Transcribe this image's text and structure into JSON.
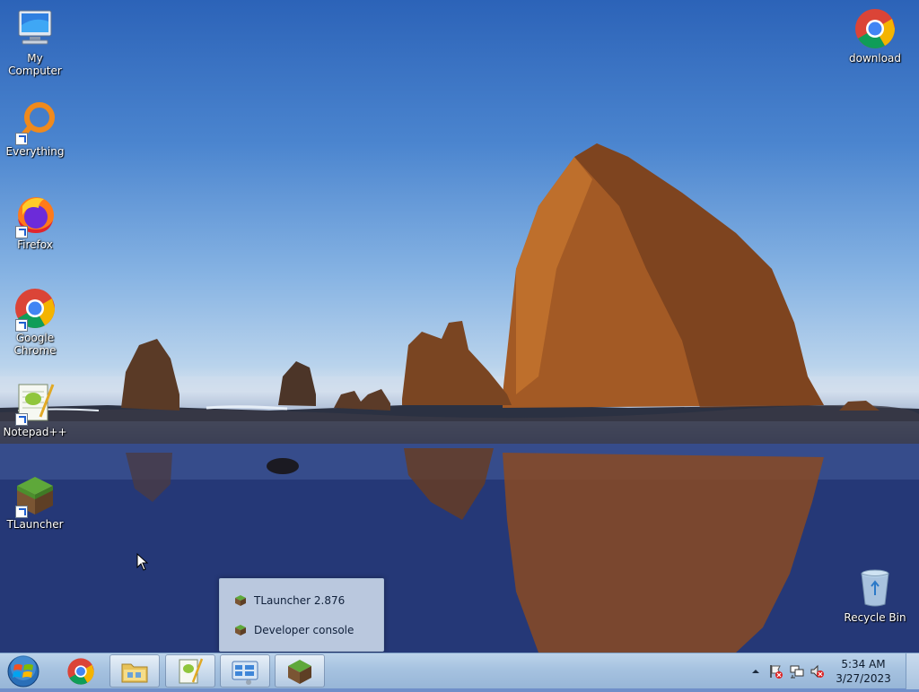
{
  "desktop": {
    "icons": [
      {
        "label": "My Computer",
        "icon": "computer-icon"
      },
      {
        "label": "Everything",
        "icon": "everything-search-icon"
      },
      {
        "label": "Firefox",
        "icon": "firefox-icon"
      },
      {
        "label": "Google Chrome",
        "icon": "chrome-icon"
      },
      {
        "label": "Notepad++",
        "icon": "notepadpp-icon"
      },
      {
        "label": "TLauncher",
        "icon": "tlauncher-grass-block-icon"
      },
      {
        "label": "download",
        "icon": "chrome-icon"
      },
      {
        "label": "Recycle Bin",
        "icon": "recycle-bin-icon"
      }
    ]
  },
  "popup": {
    "items": [
      {
        "label": "TLauncher 2.876",
        "icon": "tlauncher-grass-block-icon"
      },
      {
        "label": "Developer console",
        "icon": "tlauncher-grass-block-icon"
      }
    ]
  },
  "taskbar": {
    "buttons": [
      {
        "name": "start",
        "icon": "windows-orb-icon"
      },
      {
        "name": "chrome",
        "icon": "chrome-icon"
      },
      {
        "name": "file-explorer",
        "icon": "folder-icon"
      },
      {
        "name": "notepadpp",
        "icon": "notepadpp-icon"
      },
      {
        "name": "control-panel",
        "icon": "control-panel-icon"
      },
      {
        "name": "tlauncher",
        "icon": "tlauncher-grass-block-icon"
      }
    ],
    "tray": {
      "icons": [
        "show-hidden-icons-arrow",
        "action-center-flag-icon",
        "network-icon",
        "volume-muted-icon"
      ],
      "time": "5:34 AM",
      "date": "3/27/2023"
    }
  },
  "colors": {
    "taskbar": "#a6c2e0",
    "chrome_red": "#db4437",
    "chrome_green": "#0f9d58",
    "chrome_yellow": "#f4b400",
    "chrome_blue": "#4285f4"
  }
}
